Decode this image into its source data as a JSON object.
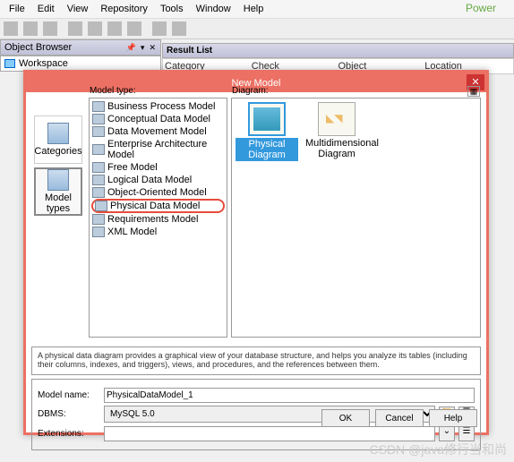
{
  "app_title": "Power",
  "menu": [
    "File",
    "Edit",
    "View",
    "Repository",
    "Tools",
    "Window",
    "Help"
  ],
  "browser": {
    "title": "Object Browser",
    "workspace": "Workspace"
  },
  "result": {
    "title": "Result List",
    "cols": [
      "Category",
      "Check",
      "Object",
      "Location"
    ]
  },
  "modal": {
    "title": "New Model",
    "close": "✕",
    "categories": {
      "cat": "Categories",
      "types": "Model types"
    },
    "model_type_hdr": "Model type:",
    "diagram_hdr": "Diagram:",
    "model_types": [
      "Business Process Model",
      "Conceptual Data Model",
      "Data Movement Model",
      "Enterprise Architecture Model",
      "Free Model",
      "Logical Data Model",
      "Object-Oriented Model",
      "Physical Data Model",
      "Requirements Model",
      "XML Model"
    ],
    "diagrams": {
      "phys": "Physical Diagram",
      "multi": "Multidimensional Diagram"
    },
    "desc": "A physical data diagram provides a graphical view of your database structure, and helps you analyze its tables (including their columns, indexes, and triggers), views, and procedures, and the references between them.",
    "form": {
      "name_lbl": "Model name:",
      "name_val": "PhysicalDataModel_1",
      "dbms_lbl": "DBMS:",
      "dbms_val": "MySQL 5.0",
      "ext_lbl": "Extensions:",
      "ext_val": ""
    },
    "buttons": {
      "ok": "OK",
      "cancel": "Cancel",
      "help": "Help"
    }
  },
  "watermark": "CSDN @java修行当和尚"
}
